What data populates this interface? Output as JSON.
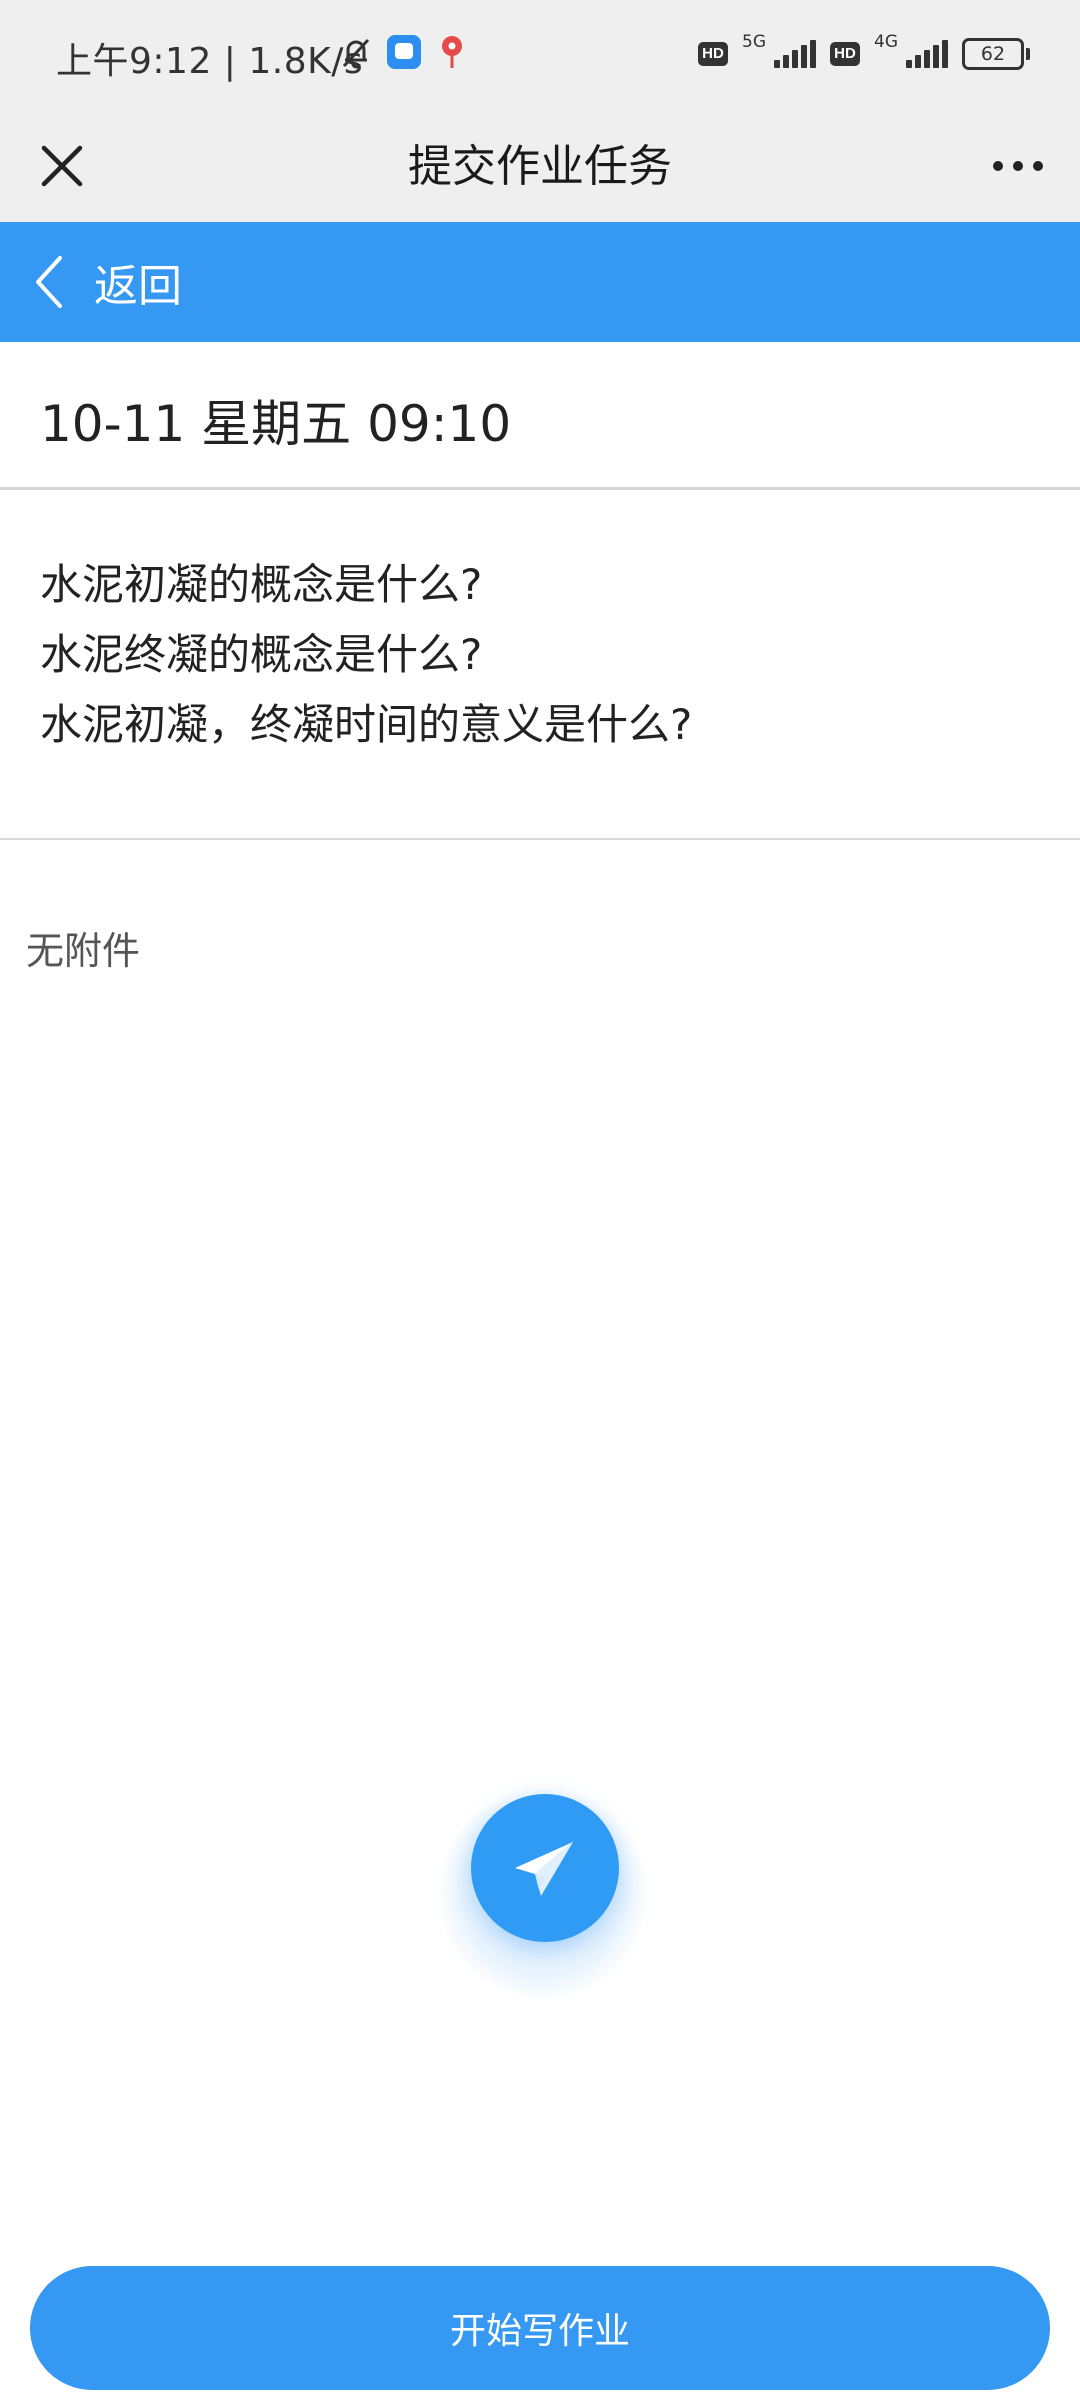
{
  "status_bar": {
    "time_text": "上午9:12 | 1.8K/s",
    "hd_badge_1": "HD",
    "network_1": "5G",
    "hd_badge_2": "HD",
    "network_2": "4G",
    "battery": "62"
  },
  "title_bar": {
    "title": "提交作业任务"
  },
  "nav": {
    "back_label": "返回"
  },
  "task": {
    "datetime": "10-11 星期五 09:10",
    "questions": [
      "水泥初凝的概念是什么?",
      "水泥终凝的概念是什么?",
      "水泥初凝，终凝时间的意义是什么?"
    ],
    "attachment_text": "无附件"
  },
  "actions": {
    "start_button_label": "开始写作业"
  },
  "colors": {
    "accent": "#3598f3",
    "header_bg": "#efefef"
  }
}
